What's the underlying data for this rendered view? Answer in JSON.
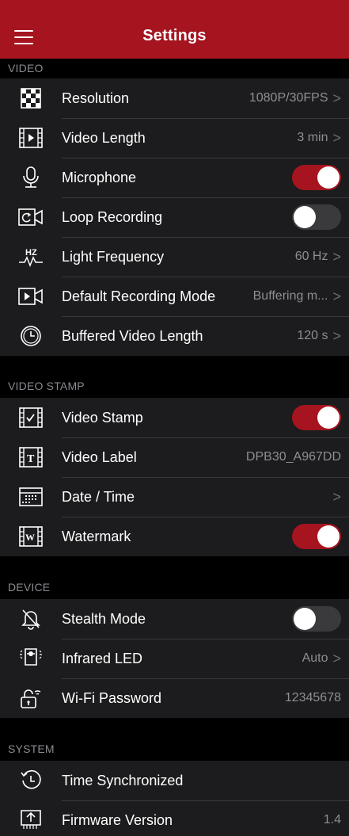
{
  "header": {
    "title": "Settings",
    "menu_icon": "hamburger-menu-icon"
  },
  "colors": {
    "accent": "#a5141f",
    "background": "#000000",
    "cell": "#1c1c1e",
    "secondary_text": "#8e8e93"
  },
  "sections": {
    "video": {
      "title": "VIDEO",
      "resolution": {
        "label": "Resolution",
        "value": "1080P/30FPS"
      },
      "video_length": {
        "label": "Video Length",
        "value": "3 min"
      },
      "microphone": {
        "label": "Microphone",
        "on": true
      },
      "loop_recording": {
        "label": "Loop Recording",
        "on": false
      },
      "light_frequency": {
        "label": "Light Frequency",
        "value": "60 Hz"
      },
      "default_recording_mode": {
        "label": "Default Recording Mode",
        "value": "Buffering m..."
      },
      "buffered_video_length": {
        "label": "Buffered Video Length",
        "value": "120 s"
      }
    },
    "video_stamp": {
      "title": "VIDEO STAMP",
      "video_stamp": {
        "label": "Video Stamp",
        "on": true
      },
      "video_label": {
        "label": "Video Label",
        "value": "DPB30_A967DD"
      },
      "date_time": {
        "label": "Date / Time"
      },
      "watermark": {
        "label": "Watermark",
        "on": true
      }
    },
    "device": {
      "title": "DEVICE",
      "stealth_mode": {
        "label": "Stealth Mode",
        "on": false
      },
      "infrared_led": {
        "label": "Infrared LED",
        "value": "Auto"
      },
      "wifi_password": {
        "label": "Wi-Fi Password",
        "value": "12345678"
      }
    },
    "system": {
      "title": "SYSTEM",
      "time_synchronized": {
        "label": "Time Synchronized"
      },
      "firmware_version": {
        "label": "Firmware Version",
        "value": "1.4"
      }
    }
  },
  "chevron": ">"
}
